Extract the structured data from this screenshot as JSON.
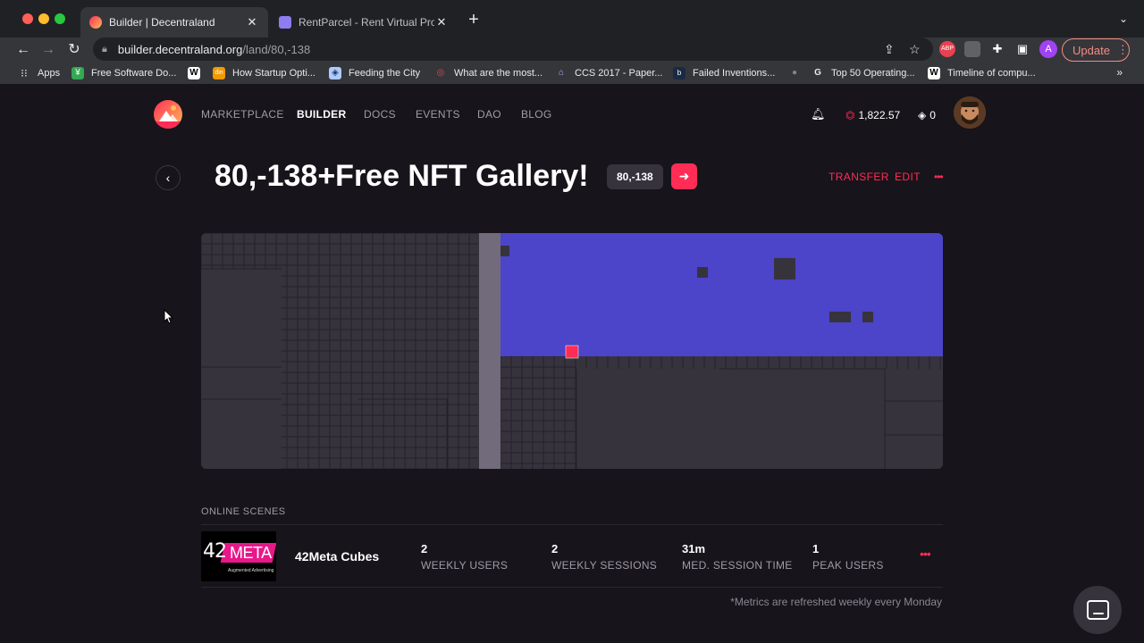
{
  "browser": {
    "tabs": [
      {
        "title": "Builder | Decentraland",
        "active": true
      },
      {
        "title": "RentParcel - Rent Virtual Prope",
        "active": false
      }
    ],
    "url_host": "builder.decentraland.org",
    "url_path": "/land/80,-138",
    "update_label": "Update",
    "profile_initial": "A",
    "extension_badge": "1",
    "bookmarks": [
      {
        "label": "Apps",
        "icon": "apps-grid-icon"
      },
      {
        "label": "Free Software Do...",
        "icon": "bookmark-green-icon"
      },
      {
        "label": "",
        "icon": "wikipedia-icon"
      },
      {
        "label": "How Startup Opti...",
        "icon": "bookmark-orange-icon"
      },
      {
        "label": "Feeding the City",
        "icon": "bookmark-shield-icon"
      },
      {
        "label": "What are the most...",
        "icon": "bookmark-quora-icon"
      },
      {
        "label": "CCS 2017 - Paper...",
        "icon": "bookmark-acm-icon"
      },
      {
        "label": "Failed Inventions...",
        "icon": "bookmark-blue-icon"
      },
      {
        "label": "",
        "icon": "apple-icon"
      },
      {
        "label": "Top 50 Operating...",
        "icon": "google-icon"
      },
      {
        "label": "Timeline of compu...",
        "icon": "wikipedia-icon"
      }
    ]
  },
  "nav": {
    "items": [
      "MARKETPLACE",
      "BUILDER",
      "DOCS",
      "EVENTS",
      "DAO",
      "BLOG"
    ],
    "active": "BUILDER",
    "mana_balance": "1,822.57",
    "eth_balance": "0"
  },
  "land": {
    "title": "80,-138+Free NFT Gallery!",
    "coords": "80,-138",
    "transfer_label": "TRANSFER",
    "edit_label": "EDIT",
    "more_label": "•••"
  },
  "colors": {
    "accent": "#ff2d55",
    "estate_highlight": "#4c44c9",
    "atlas_bg": "#37333d",
    "road": "#716b7c"
  },
  "online_scenes": {
    "heading": "ONLINE SCENES",
    "scene": {
      "name": "42Meta Cubes",
      "thumb_number": "42",
      "thumb_brand": "META",
      "thumb_tagline": "Augmented Advertising",
      "stats": [
        {
          "value": "2",
          "label": "WEEKLY USERS"
        },
        {
          "value": "2",
          "label": "WEEKLY SESSIONS"
        },
        {
          "value": "31m",
          "label": "MED. SESSION TIME"
        },
        {
          "value": "1",
          "label": "PEAK USERS"
        }
      ],
      "more_label": "•••"
    },
    "footnote": "*Metrics are refreshed weekly every Monday"
  }
}
